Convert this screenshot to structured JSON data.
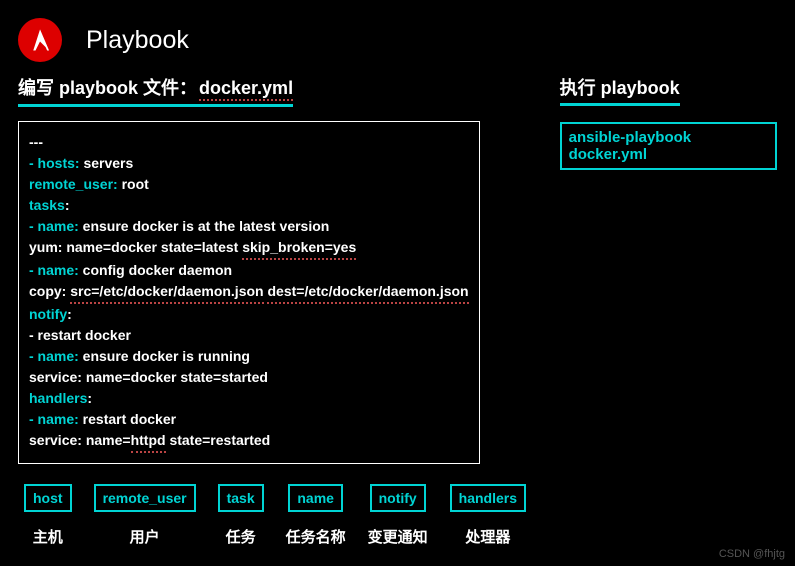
{
  "header": {
    "title": "Playbook"
  },
  "left": {
    "heading_prefix": "编写 playbook 文件：",
    "heading_filename": "docker.yml",
    "code": {
      "l1": "---",
      "l2a": "- hosts:",
      "l2b": " servers",
      "l3a": "  remote_user:",
      "l3b": " root",
      "l4": "  tasks:",
      "l5a": "   - name:",
      "l5b": " ensure docker is at the latest version",
      "l6a": "     yum: name=docker state=latest ",
      "l6b": "skip_broken=yes",
      "l7a": "   - name:",
      "l7b": " config docker daemon",
      "l8a": "     copy: ",
      "l8b": "src=/etc/docker/daemon.json",
      "l8c": " ",
      "l8d": "dest=/etc/docker/daemon.json",
      "l9": "     notify:",
      "l10": "      - restart docker",
      "l11a": "   - name:",
      "l11b": " ensure docker is running",
      "l12": "     service: name=docker state=started",
      "l13": "  handlers:",
      "l14a": "    - name:",
      "l14b": " restart docker",
      "l15a": "      service: name=",
      "l15b": "httpd",
      "l15c": " state=restarted"
    }
  },
  "right": {
    "heading": "执行 playbook",
    "command": "ansible-playbook docker.yml"
  },
  "tags": [
    {
      "key": "host",
      "label": "主机"
    },
    {
      "key": "remote_user",
      "label": "用户"
    },
    {
      "key": "task",
      "label": "任务"
    },
    {
      "key": "name",
      "label": "任务名称"
    },
    {
      "key": "notify",
      "label": "变更通知"
    },
    {
      "key": "handlers",
      "label": "处理器"
    }
  ],
  "watermark": "CSDN @fhjtg"
}
